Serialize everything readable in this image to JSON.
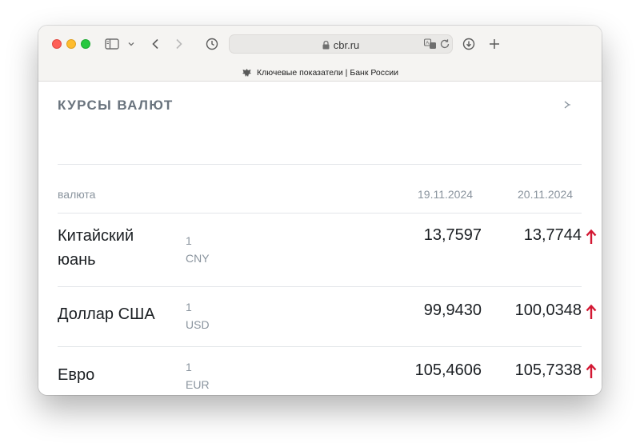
{
  "browser": {
    "url_host": "cbr.ru",
    "tab_title": "Ключевые показатели | Банк России"
  },
  "rates_widget": {
    "title": "КУРСЫ ВАЛЮТ",
    "columns": {
      "currency": "валюта",
      "date_prev": "19.11.2024",
      "date_curr": "20.11.2024"
    },
    "rows": [
      {
        "name_line1": "Китайский",
        "name_line2": "юань",
        "amount": "1",
        "code": "CNY",
        "prev": "13,7597",
        "curr": "13,7744",
        "trend": "up-arrow-icon"
      },
      {
        "name_line1": "Доллар США",
        "name_line2": "",
        "amount": "1",
        "code": "USD",
        "prev": "99,9430",
        "curr": "100,0348",
        "trend": "up-arrow-icon"
      },
      {
        "name_line1": "Евро",
        "name_line2": "",
        "amount": "1",
        "code": "EUR",
        "prev": "105,4606",
        "curr": "105,7338",
        "trend": "up-arrow-icon"
      }
    ]
  },
  "colors": {
    "accent_up": "#d31833",
    "title_gray": "#69737d",
    "muted_gray": "#8a949e"
  }
}
